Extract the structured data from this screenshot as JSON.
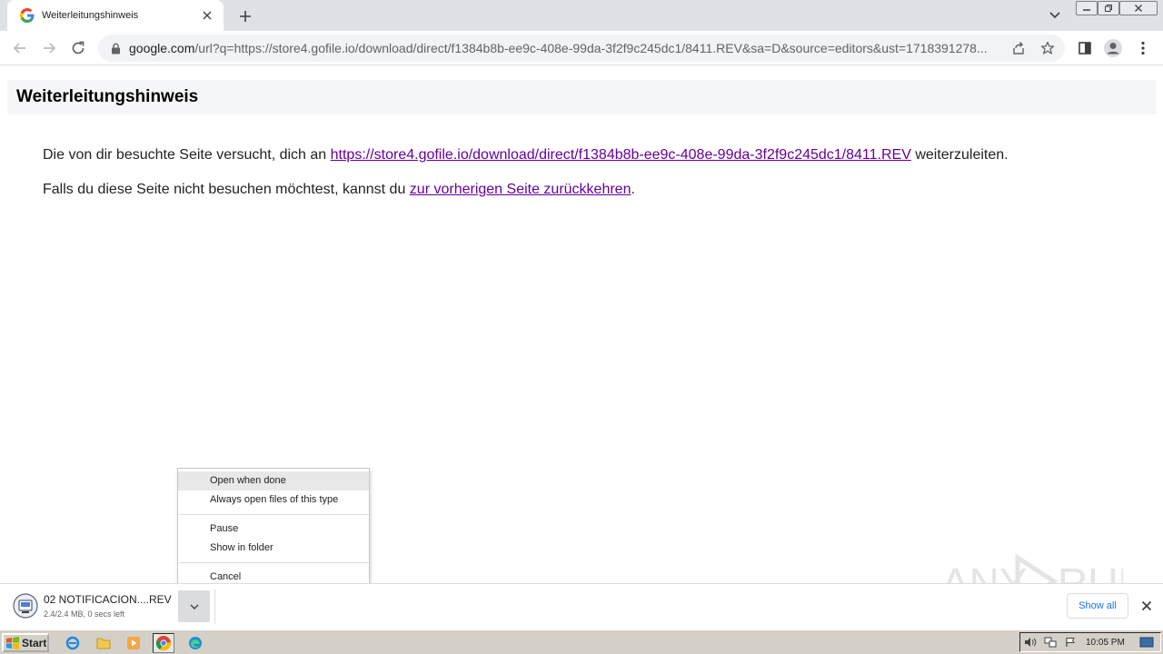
{
  "browser": {
    "tab": {
      "title": "Weiterleitungshinweis"
    },
    "omnibox": {
      "url_host": "google.com",
      "url_rest": "/url?q=https://store4.gofile.io/download/direct/f1384b8b-ee9c-408e-99da-3f2f9c245dc1/8411.REV&sa=D&source=editors&ust=1718391278..."
    }
  },
  "page": {
    "heading": "Weiterleitungshinweis",
    "line1_prefix": "Die von dir besuchte Seite versucht, dich an ",
    "line1_link": "https://store4.gofile.io/download/direct/f1384b8b-ee9c-408e-99da-3f2f9c245dc1/8411.REV",
    "line1_suffix": " weiterzuleiten.",
    "line2_prefix": "Falls du diese Seite nicht besuchen möchtest, kannst du ",
    "line2_link": "zur vorherigen Seite zurückkehren",
    "line2_suffix": "."
  },
  "context_menu": {
    "items": [
      {
        "label": "Open when done"
      },
      {
        "label": "Always open files of this type"
      },
      {
        "label": "Pause"
      },
      {
        "label": "Show in folder"
      },
      {
        "label": "Cancel"
      }
    ]
  },
  "download_shelf": {
    "filename": "02 NOTIFICACION....REV",
    "status": "2.4/2.4 MB, 0 secs left",
    "show_all": "Show all"
  },
  "watermark": {
    "text": "ANY RUN"
  },
  "taskbar": {
    "start_label": "Start",
    "clock": "10:05 PM"
  },
  "colors": {
    "link_visited": "#660099",
    "chrome_tabstrip": "#dee1e6",
    "accent_blue": "#1a73e8",
    "taskbar": "#d4d0c8"
  }
}
